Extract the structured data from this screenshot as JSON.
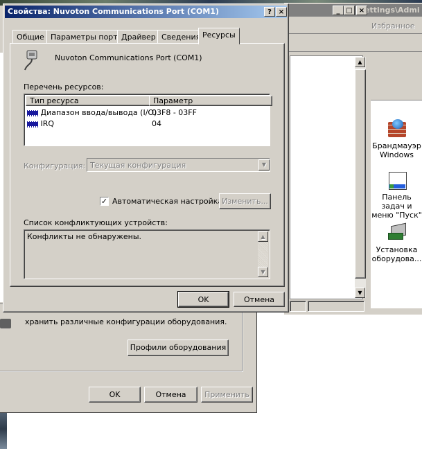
{
  "background_window": {
    "title_fragment": "ettings\\Admi",
    "toolbar_item": "Избранное",
    "desktop_icons": [
      {
        "label": "Брандмауэр Windows",
        "icon": "firewall-icon"
      },
      {
        "label": "Панель задач и меню \"Пуск\"",
        "icon": "taskbar-icon"
      },
      {
        "label": "Установка оборудова...",
        "icon": "hardware-install-icon"
      }
    ]
  },
  "system_props": {
    "hw_text": "хранить различные конфигурации оборудования.",
    "hw_profiles_button": "Профили оборудования",
    "ok_button": "OK",
    "cancel_button": "Отмена",
    "apply_button": "Применить"
  },
  "dialog": {
    "title": "Свойства: Nuvoton Communications Port (COM1)",
    "help_btn": "?",
    "close_btn": "×",
    "tabs": [
      {
        "label": "Общие",
        "active": false
      },
      {
        "label": "Параметры порта",
        "active": false
      },
      {
        "label": "Драйвер",
        "active": false
      },
      {
        "label": "Сведения",
        "active": false
      },
      {
        "label": "Ресурсы",
        "active": true
      }
    ],
    "device_name": "Nuvoton Communications Port (COM1)",
    "resources_label": "Перечень ресурсов:",
    "table": {
      "headers": [
        "Тип ресурса",
        "Параметр"
      ],
      "rows": [
        {
          "type": "Диапазон ввода/вывода (I/O)",
          "value": "03F8 - 03FF"
        },
        {
          "type": "IRQ",
          "value": "04"
        }
      ]
    },
    "config_label": "Конфигурация:",
    "config_value": "Текущая конфигурация",
    "auto_checkbox_label": "Автоматическая настройка",
    "auto_checked": true,
    "change_button": "Изменить...",
    "conflicts_label": "Список конфликтующих устройств:",
    "conflicts_text": "Конфликты не обнаружены.",
    "ok_button": "OK",
    "cancel_button": "Отмена"
  },
  "colors": {
    "title_active": "#0a246a",
    "title_inactive": "#808080",
    "face": "#d4d0c8"
  }
}
